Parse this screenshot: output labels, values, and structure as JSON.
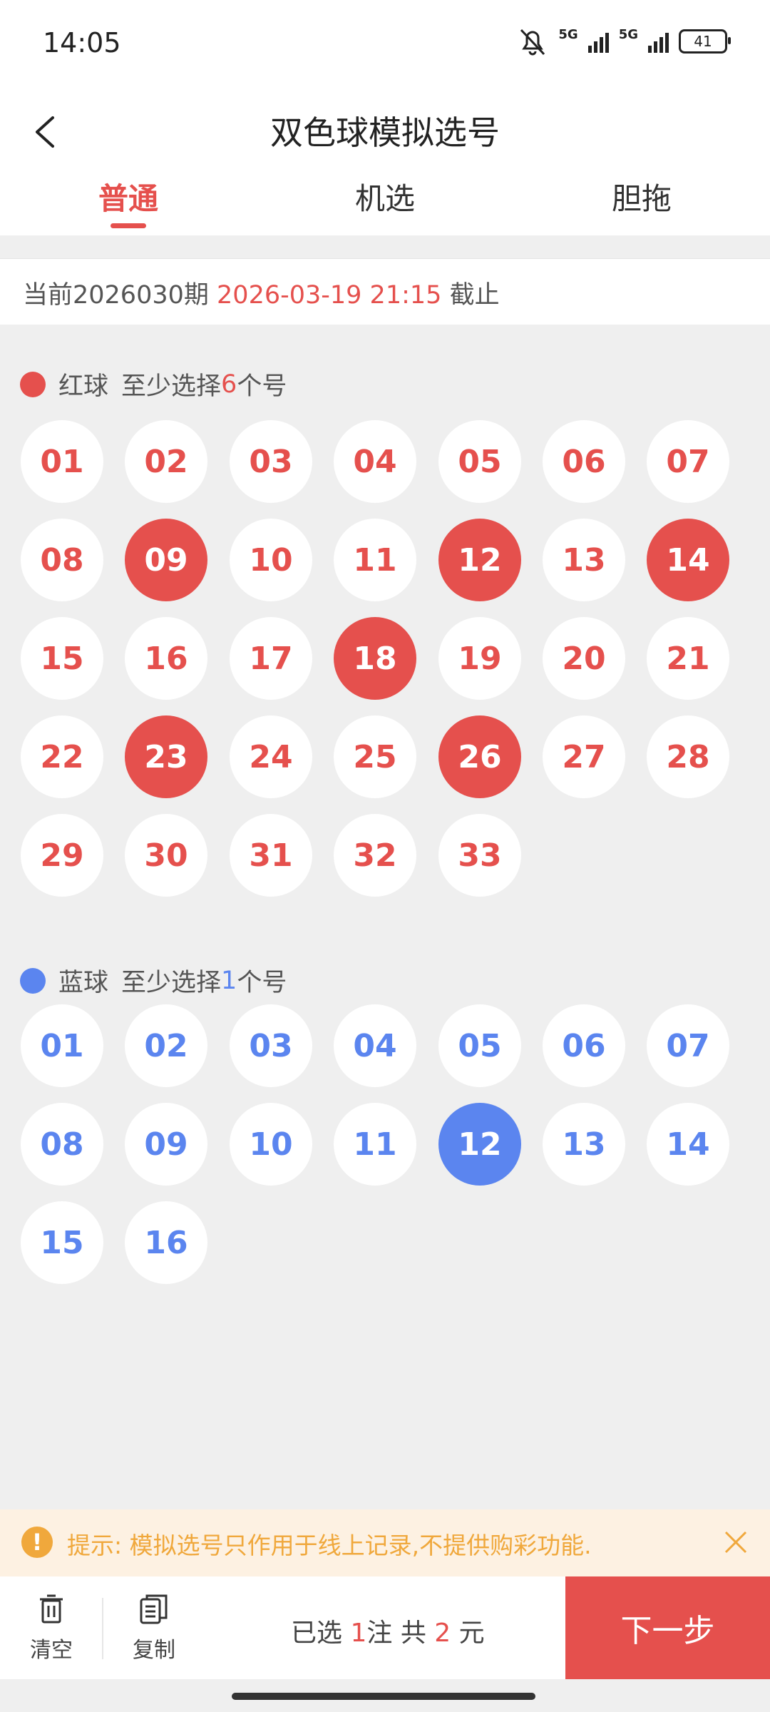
{
  "status_bar": {
    "time": "14:05",
    "network1": "5G",
    "network2": "5G",
    "battery": "41"
  },
  "header": {
    "title": "双色球模拟选号"
  },
  "tabs": [
    {
      "label": "普通",
      "active": true
    },
    {
      "label": "机选",
      "active": false
    },
    {
      "label": "胆拖",
      "active": false
    }
  ],
  "period": {
    "prefix": "当前2026030期",
    "deadline": "2026-03-19 21:15",
    "suffix": "截止"
  },
  "red_section": {
    "name": "红球",
    "hint_prefix": "至少选择",
    "min": "6",
    "hint_suffix": "个号"
  },
  "red_balls": [
    "01",
    "02",
    "03",
    "04",
    "05",
    "06",
    "07",
    "08",
    "09",
    "10",
    "11",
    "12",
    "13",
    "14",
    "15",
    "16",
    "17",
    "18",
    "19",
    "20",
    "21",
    "22",
    "23",
    "24",
    "25",
    "26",
    "27",
    "28",
    "29",
    "30",
    "31",
    "32",
    "33"
  ],
  "red_selected": [
    "09",
    "12",
    "14",
    "18",
    "23",
    "26"
  ],
  "blue_section": {
    "name": "蓝球",
    "hint_prefix": "至少选择",
    "min": "1",
    "hint_suffix": "个号"
  },
  "blue_balls": [
    "01",
    "02",
    "03",
    "04",
    "05",
    "06",
    "07",
    "08",
    "09",
    "10",
    "11",
    "12",
    "13",
    "14",
    "15",
    "16"
  ],
  "blue_selected": [
    "12"
  ],
  "colors": {
    "red": "#e5504d",
    "blue": "#5b85ef",
    "hint": "#f0a83c"
  },
  "hint": {
    "text": "提示: 模拟选号只作用于线上记录,不提供购彩功能."
  },
  "bottom": {
    "clear_label": "清空",
    "copy_label": "复制",
    "summary_prefix": "已选",
    "bets": "1",
    "summary_mid": "注 共",
    "amount": "2",
    "summary_suffix": "元",
    "next_label": "下一步"
  }
}
